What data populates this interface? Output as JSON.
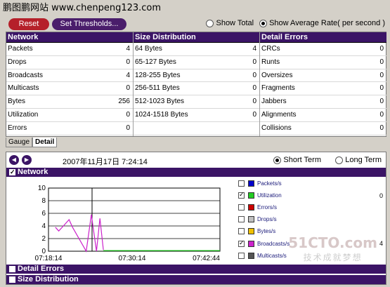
{
  "header_watermark": "鹏图鹏网站   www.chenpeng123.com",
  "toolbar": {
    "reset": "Reset",
    "set_thresholds": "Set Thresholds...",
    "show_total": "Show Total",
    "show_average": "Show Average Rate( per second )"
  },
  "network": {
    "title": "Network",
    "rows": [
      {
        "label": "Packets",
        "value": "4"
      },
      {
        "label": "Drops",
        "value": "0"
      },
      {
        "label": "Broadcasts",
        "value": "4"
      },
      {
        "label": "Multicasts",
        "value": "0"
      },
      {
        "label": "Bytes",
        "value": "256"
      },
      {
        "label": "Utilization",
        "value": "0"
      },
      {
        "label": "Errors",
        "value": "0"
      }
    ]
  },
  "size": {
    "title": "Size Distribution",
    "rows": [
      {
        "label": "64 Bytes",
        "value": "4"
      },
      {
        "label": "65-127 Bytes",
        "value": "0"
      },
      {
        "label": "128-255 Bytes",
        "value": "0"
      },
      {
        "label": "256-511 Bytes",
        "value": "0"
      },
      {
        "label": "512-1023 Bytes",
        "value": "0"
      },
      {
        "label": "1024-1518 Bytes",
        "value": "0"
      },
      {
        "label": "",
        "value": ""
      }
    ]
  },
  "errors": {
    "title": "Detail Errors",
    "rows": [
      {
        "label": "CRCs",
        "value": "0"
      },
      {
        "label": "Runts",
        "value": "0"
      },
      {
        "label": "Oversizes",
        "value": "0"
      },
      {
        "label": "Fragments",
        "value": "0"
      },
      {
        "label": "Jabbers",
        "value": "0"
      },
      {
        "label": "Alignments",
        "value": "0"
      },
      {
        "label": "Collisions",
        "value": "0"
      }
    ]
  },
  "tabs": [
    "Gauge",
    "Detail"
  ],
  "panel": {
    "timestamp": "2007年11月17日  7:24:14",
    "short_term": "Short Term",
    "long_term": "Long Term",
    "network_section": "Network",
    "detail_errors_section": "Detail Errors",
    "size_section": "Size Distribution"
  },
  "legend": [
    {
      "name": "Packets/s",
      "color": "#0000cc",
      "checked": false,
      "value": ""
    },
    {
      "name": "Utilization",
      "color": "#22cc22",
      "checked": true,
      "value": "0"
    },
    {
      "name": "Errors/s",
      "color": "#cc0000",
      "checked": false,
      "value": ""
    },
    {
      "name": "Drops/s",
      "color": "#c0c0c0",
      "checked": false,
      "value": ""
    },
    {
      "name": "Bytes/s",
      "color": "#f0c000",
      "checked": false,
      "value": ""
    },
    {
      "name": "Broadcasts/s",
      "color": "#cc22cc",
      "checked": true,
      "value": "4"
    },
    {
      "name": "Multicasts/s",
      "color": "#555555",
      "checked": false,
      "value": ""
    }
  ],
  "chart_data": {
    "type": "line",
    "yticks": [
      "10",
      "8",
      "6",
      "4",
      "2",
      "0"
    ],
    "ylim": [
      0,
      10
    ],
    "xticks": [
      "07:18:14",
      "07:30:14",
      "07:42:44"
    ],
    "series": [
      {
        "name": "Broadcasts/s",
        "color": "#cc22cc",
        "points": [
          [
            0.04,
            3.8
          ],
          [
            0.06,
            3.2
          ],
          [
            0.09,
            4.1
          ],
          [
            0.12,
            5.0
          ],
          [
            0.14,
            3.8
          ],
          [
            0.22,
            0
          ],
          [
            0.25,
            5.8
          ],
          [
            0.28,
            0
          ],
          [
            0.3,
            5.2
          ],
          [
            0.32,
            0.2
          ]
        ]
      },
      {
        "name": "Utilization",
        "color": "#22cc22",
        "points": [
          [
            0.32,
            0.1
          ],
          [
            1.0,
            0.1
          ]
        ]
      }
    ]
  }
}
